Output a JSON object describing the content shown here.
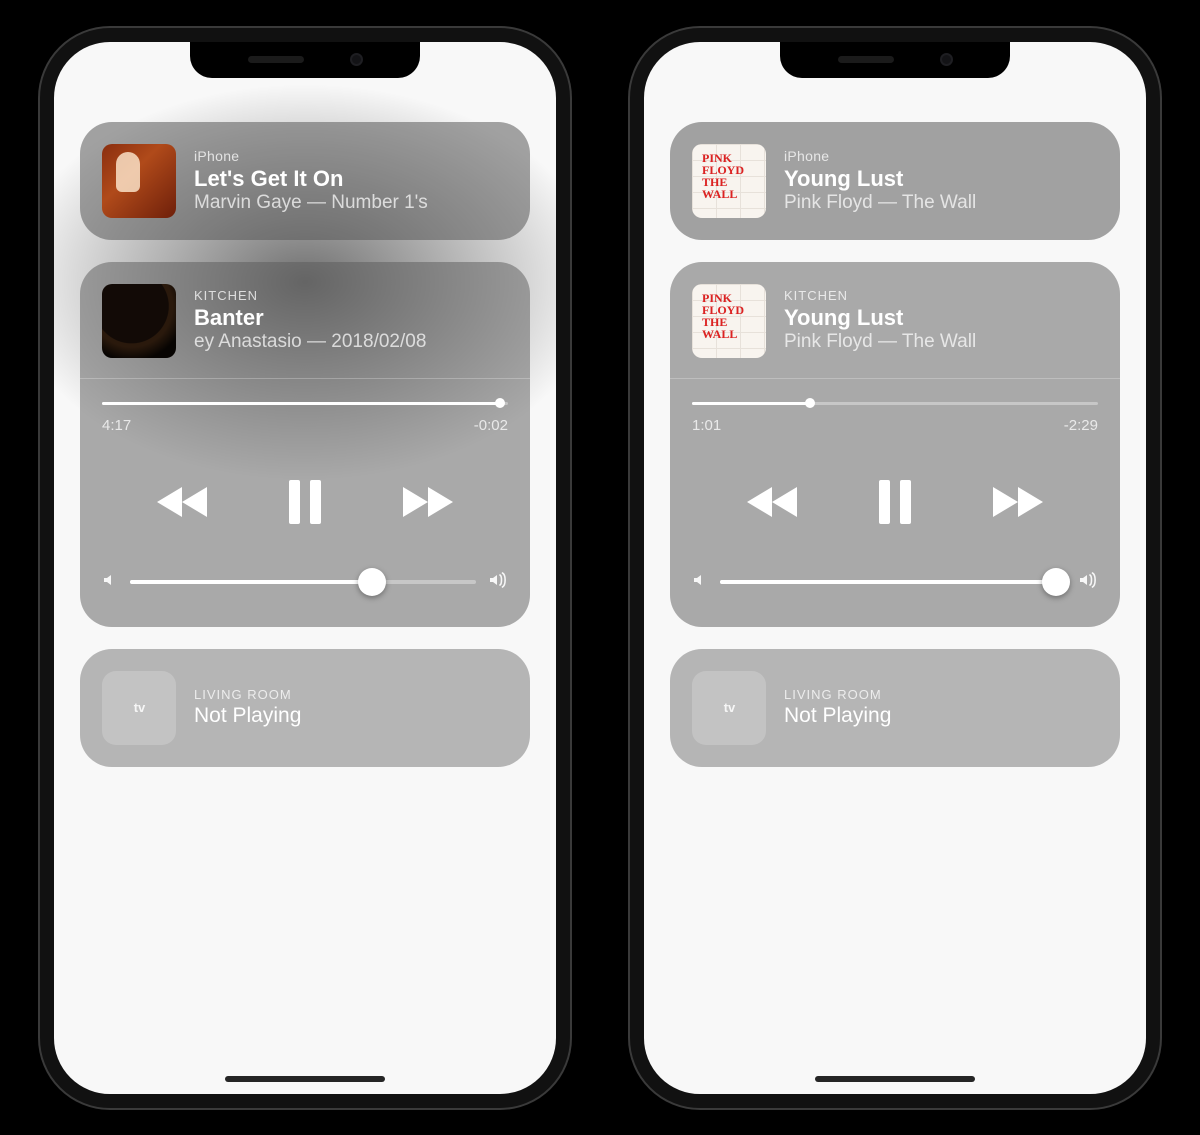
{
  "phones": [
    {
      "top_card": {
        "device": "iPhone",
        "title": "Let's Get It On",
        "subtitle": "Marvin Gaye — Number 1's",
        "art": "marvin"
      },
      "player": {
        "device": "KITCHEN",
        "title": "Banter",
        "subtitle": "ey Anastasio — 2018/02/08",
        "art": "phish",
        "elapsed": "4:17",
        "remaining": "-0:02",
        "progress_pct": 98,
        "volume_pct": 70
      },
      "tv": {
        "device": "LIVING ROOM",
        "status": "Not Playing"
      }
    },
    {
      "top_card": {
        "device": "iPhone",
        "title": "Young Lust",
        "subtitle": "Pink Floyd — The Wall",
        "art": "wall"
      },
      "player": {
        "device": "KITCHEN",
        "title": "Young Lust",
        "subtitle": "Pink Floyd — The Wall",
        "art": "wall",
        "elapsed": "1:01",
        "remaining": "-2:29",
        "progress_pct": 29,
        "volume_pct": 97
      },
      "tv": {
        "device": "LIVING ROOM",
        "status": "Not Playing"
      }
    }
  ],
  "wall_art_text": "PINK\nFLOYD\nTHE\nWALL",
  "atv_label": "tv"
}
